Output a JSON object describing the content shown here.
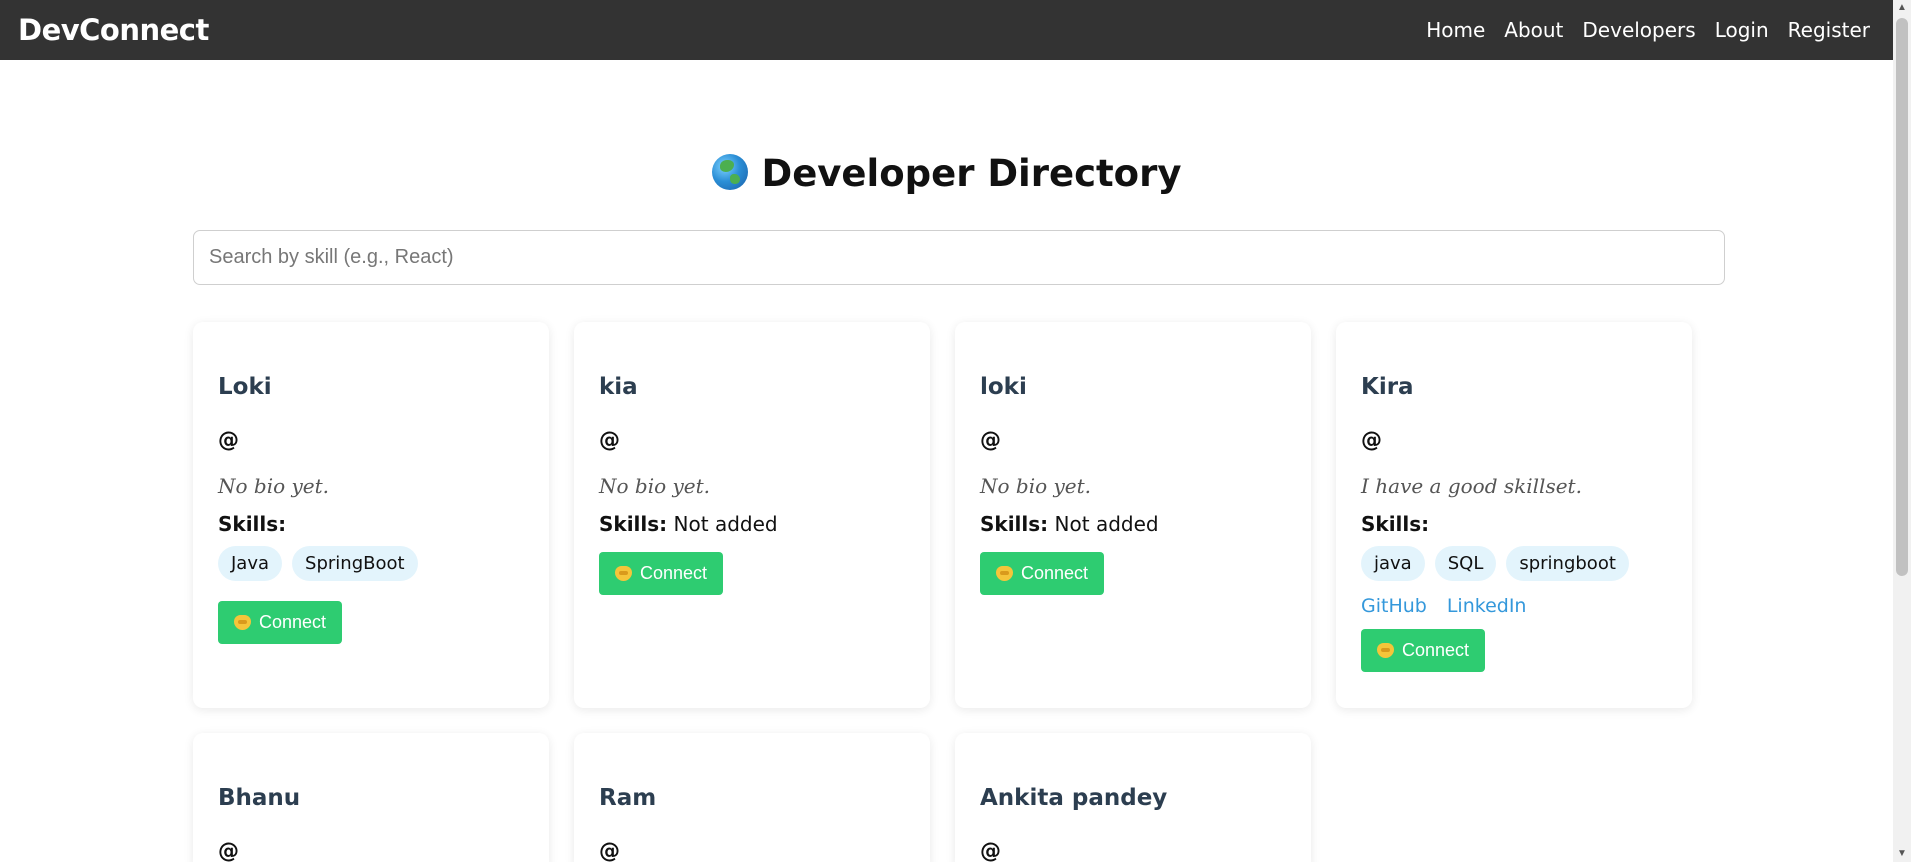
{
  "navbar": {
    "brand": "DevConnect",
    "links": [
      "Home",
      "About",
      "Developers",
      "Login",
      "Register"
    ]
  },
  "page": {
    "title": "Developer Directory",
    "title_icon": "globe-icon"
  },
  "search": {
    "placeholder": "Search by skill (e.g., React)",
    "value": ""
  },
  "labels": {
    "skills": "Skills:",
    "connect": "Connect",
    "connect_icon": "handshake-icon"
  },
  "developers": [
    {
      "name": "Loki",
      "handle": "@",
      "bio": "No bio yet.",
      "skills": [
        "Java",
        "SpringBoot"
      ],
      "skills_text": "",
      "links": []
    },
    {
      "name": "kia",
      "handle": "@",
      "bio": "No bio yet.",
      "skills": [],
      "skills_text": "Not added",
      "links": []
    },
    {
      "name": "loki",
      "handle": "@",
      "bio": "No bio yet.",
      "skills": [],
      "skills_text": "Not added",
      "links": []
    },
    {
      "name": "Kira",
      "handle": "@",
      "bio": "I have a good skillset.",
      "skills": [
        "java",
        "SQL",
        "springboot"
      ],
      "skills_text": "",
      "links": [
        "GitHub",
        "LinkedIn"
      ]
    },
    {
      "name": "Bhanu",
      "handle": "@"
    },
    {
      "name": "Ram",
      "handle": "@"
    },
    {
      "name": "Ankita pandey",
      "handle": "@"
    }
  ],
  "colors": {
    "navbar_bg": "#333333",
    "connect_bg": "#2ecc71",
    "chip_bg": "#e3f4fc",
    "link": "#3498db",
    "name": "#2c3e50"
  }
}
